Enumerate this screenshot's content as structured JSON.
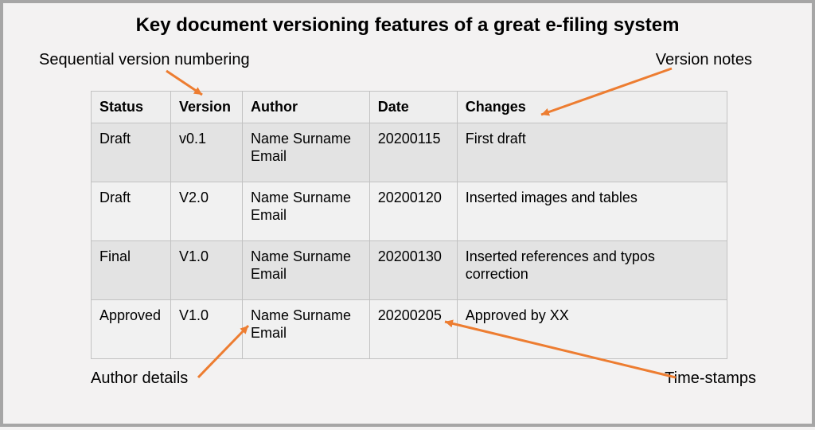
{
  "title": "Key document versioning features of a great e-filing system",
  "callouts": {
    "version_numbering": "Sequential version numbering",
    "version_notes": "Version notes",
    "author_details": "Author details",
    "time_stamps": "Time-stamps"
  },
  "table": {
    "headers": {
      "status": "Status",
      "version": "Version",
      "author": "Author",
      "date": "Date",
      "changes": "Changes"
    },
    "rows": [
      {
        "status": "Draft",
        "version": "v0.1",
        "author": "Name Surname Email",
        "date": "20200115",
        "changes": "First draft"
      },
      {
        "status": "Draft",
        "version": "V2.0",
        "author": "Name Surname Email",
        "date": "20200120",
        "changes": "Inserted images and tables"
      },
      {
        "status": "Final",
        "version": "V1.0",
        "author": "Name Surname Email",
        "date": "20200130",
        "changes": "Inserted references and typos correction"
      },
      {
        "status": "Approved",
        "version": "V1.0",
        "author": "Name Surname Email",
        "date": "20200205",
        "changes": "Approved by XX"
      }
    ]
  }
}
